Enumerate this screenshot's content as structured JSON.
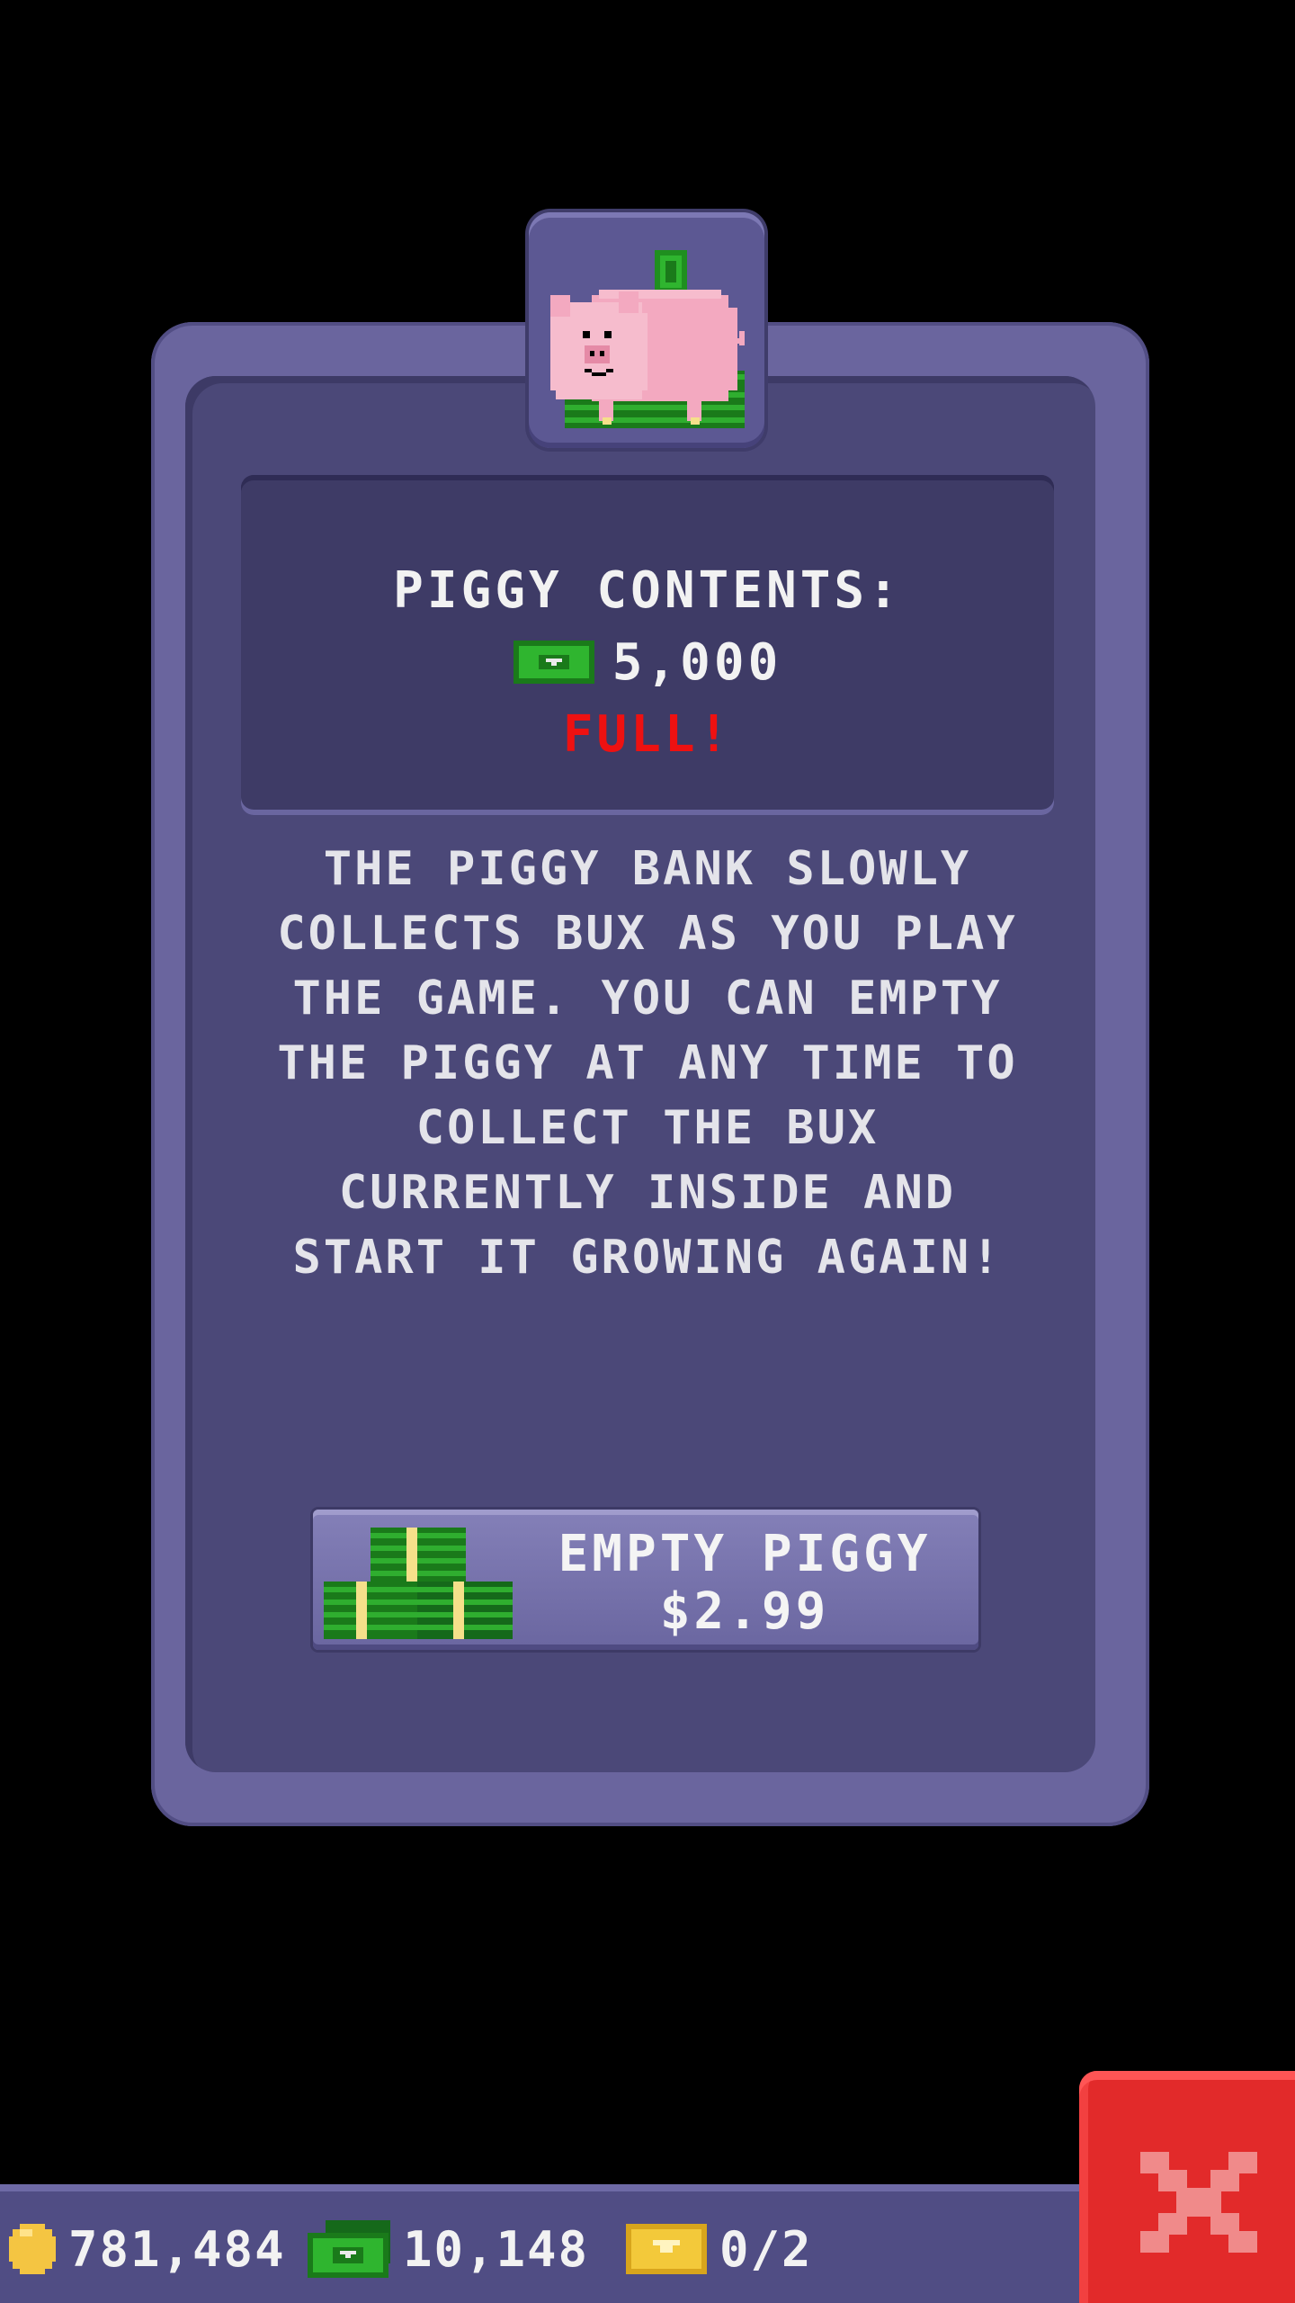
{
  "piggy_tile": {
    "icon": "piggy-bank-icon"
  },
  "contents": {
    "title": "PIGGY CONTENTS:",
    "amount": "5,000",
    "currency_icon": "bux-bill-icon",
    "status": "FULL!",
    "status_color": "#ee1111"
  },
  "description": "THE PIGGY BANK SLOWLY\nCOLLECTS BUX AS YOU PLAY\nTHE GAME. YOU CAN EMPTY\nTHE PIGGY AT ANY TIME TO\nCOLLECT THE BUX\nCURRENTLY INSIDE AND\nSTART IT GROWING AGAIN!",
  "empty_button": {
    "label_line1": "EMPTY PIGGY",
    "label_line2": "$2.99",
    "icon": "bux-stack-icon"
  },
  "status_bar": {
    "coins": "781,484",
    "coins_icon": "coin-icon",
    "bux": "10,148",
    "bux_icon": "bux-bill-icon",
    "tickets": "0/2",
    "tickets_icon": "gold-ticket-icon"
  },
  "close_button": {
    "icon": "close-icon",
    "color": "#e22a2a"
  }
}
